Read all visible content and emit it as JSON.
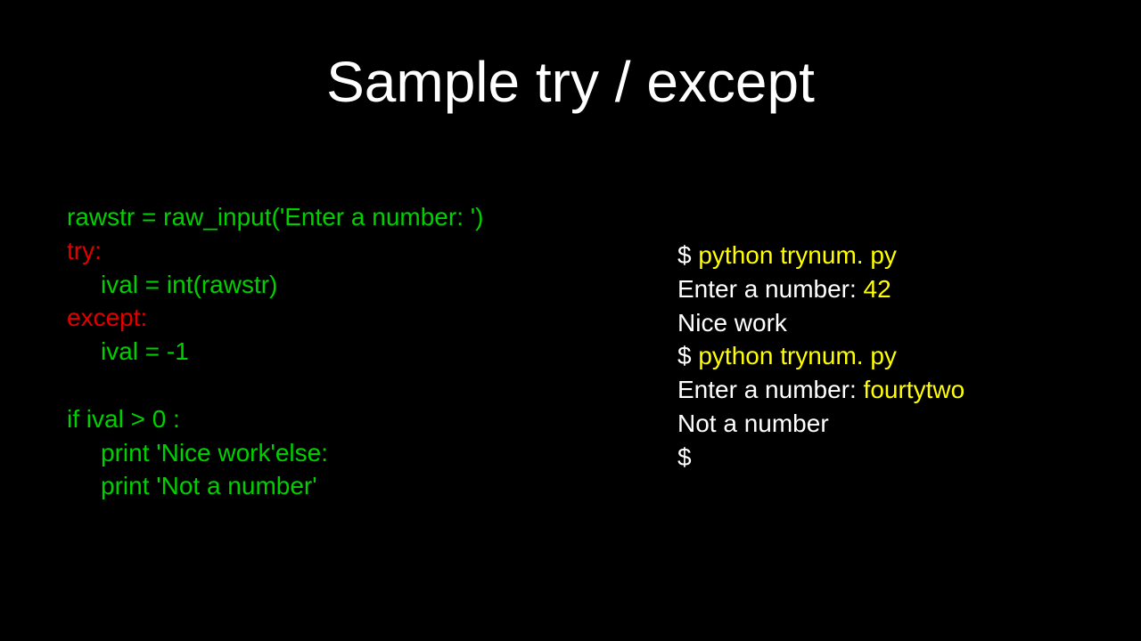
{
  "title": "Sample try / except",
  "code": {
    "l1": "rawstr = raw_input('Enter a number: ')",
    "l2": "try:",
    "l3": "ival = int(rawstr)",
    "l4": "except:",
    "l5": "ival = -1",
    "l6": "if ival > 0 :",
    "l7a": "print 'Nice work'",
    "l7b": "else:",
    "l8": "print 'Not a number'"
  },
  "output": {
    "l1a": "$ ",
    "l1b": "python trynum. py",
    "l2a": "Enter a number:",
    "l2b": " 42",
    "l3": "Nice work",
    "l4a": "$ ",
    "l4b": "python trynum. py",
    "l5a": "Enter a number:",
    "l5b": " fourtytwo",
    "l6": "Not a number",
    "l7": "$"
  }
}
